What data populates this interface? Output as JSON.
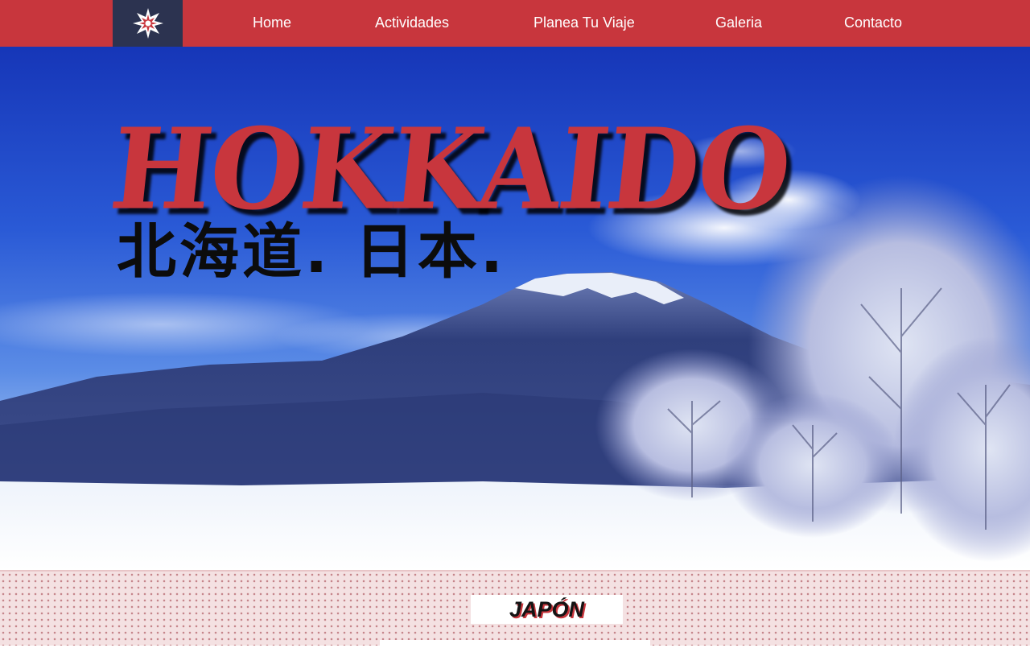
{
  "nav": {
    "logo_icon": "hokkaido-star-emblem-icon",
    "items": [
      {
        "label": "Home"
      },
      {
        "label": "Actividades"
      },
      {
        "label": "Planea Tu Viaje"
      },
      {
        "label": "Galeria"
      },
      {
        "label": "Contacto"
      }
    ]
  },
  "hero": {
    "title": "HOKKAIDO",
    "subtitle": "北海道. 日本."
  },
  "section": {
    "heading": "JAPÓN"
  },
  "colors": {
    "accent_red": "#c8363d",
    "logo_navy": "#2c3350",
    "section_bg": "#f4e1e2"
  }
}
